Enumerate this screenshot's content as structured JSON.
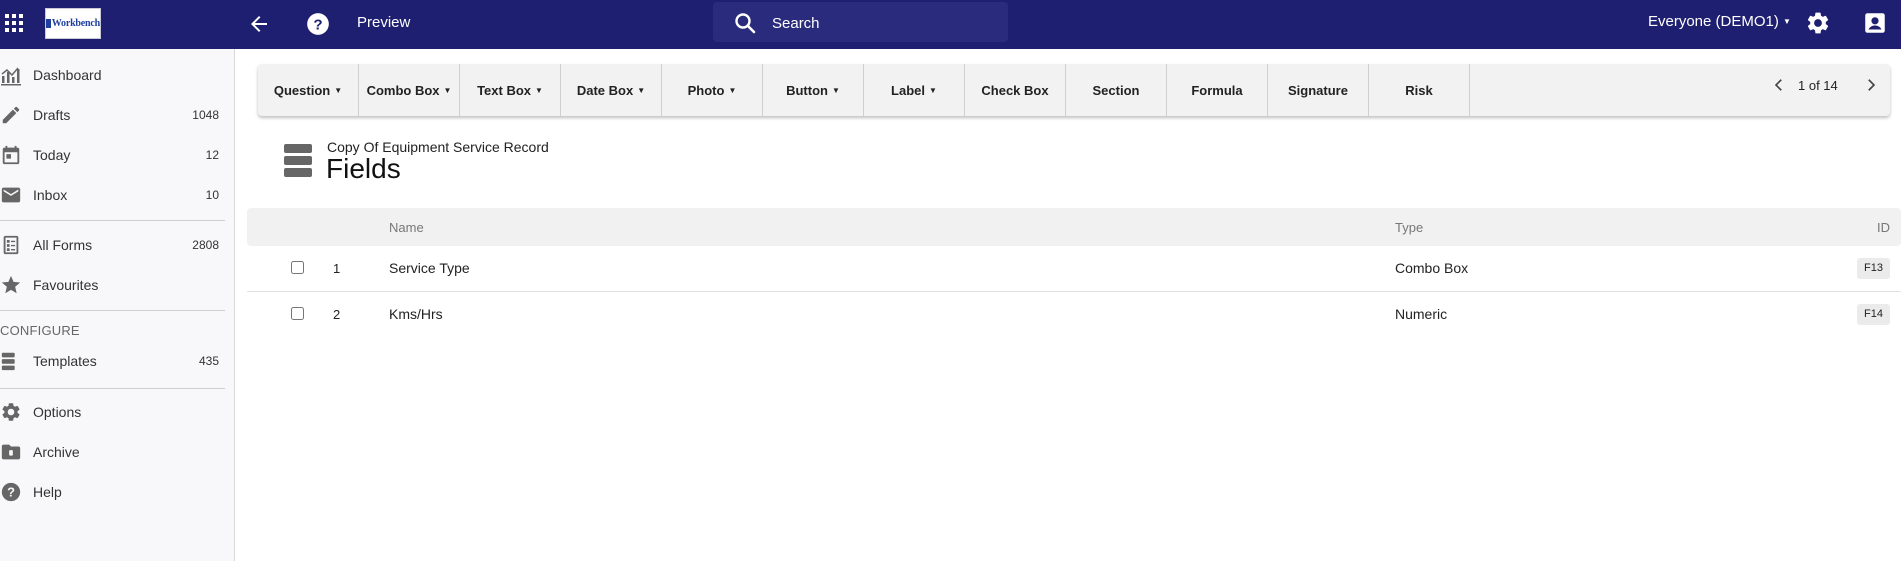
{
  "topbar": {
    "logo_text": "Workbench",
    "preview_label": "Preview",
    "search_placeholder": "Search",
    "workspace_label": "Everyone (DEMO1)",
    "icons": [
      "apps-grid-icon",
      "back-arrow-icon",
      "help-icon",
      "search-icon",
      "settings-gear-icon",
      "account-icon"
    ],
    "colors": {
      "background": "#1f1f71",
      "search_background": "#2b2b7e",
      "text": "#ffffff"
    }
  },
  "sidebar": {
    "items": [
      {
        "label": "Dashboard",
        "count": "",
        "icon": "chart-icon"
      },
      {
        "label": "Drafts",
        "count": "1048",
        "icon": "pencil-icon"
      },
      {
        "label": "Today",
        "count": "12",
        "icon": "calendar-icon"
      },
      {
        "label": "Inbox",
        "count": "10",
        "icon": "mail-icon"
      },
      {
        "label": "All Forms",
        "count": "2808",
        "icon": "forms-list-icon"
      },
      {
        "label": "Favourites",
        "count": "",
        "icon": "star-icon"
      },
      {
        "label": "Templates",
        "count": "435",
        "icon": "stack-icon"
      },
      {
        "label": "Options",
        "count": "",
        "icon": "gear-icon"
      },
      {
        "label": "Archive",
        "count": "",
        "icon": "archive-icon"
      },
      {
        "label": "Help",
        "count": "",
        "icon": "help-circle-icon"
      }
    ],
    "section_configure": "CONFIGURE"
  },
  "toolbar": {
    "buttons": [
      {
        "label": "Question",
        "dropdown": true
      },
      {
        "label": "Combo Box",
        "dropdown": true
      },
      {
        "label": "Text Box",
        "dropdown": true
      },
      {
        "label": "Date Box",
        "dropdown": true
      },
      {
        "label": "Photo",
        "dropdown": true
      },
      {
        "label": "Button",
        "dropdown": true
      },
      {
        "label": "Label",
        "dropdown": true
      },
      {
        "label": "Check Box",
        "dropdown": false
      },
      {
        "label": "Section",
        "dropdown": false
      },
      {
        "label": "Formula",
        "dropdown": false
      },
      {
        "label": "Signature",
        "dropdown": false
      },
      {
        "label": "Risk",
        "dropdown": false
      }
    ],
    "pager_text": "1 of 14"
  },
  "page": {
    "subtitle": "Copy Of Equipment Service Record",
    "title": "Fields"
  },
  "table": {
    "columns": {
      "name": "Name",
      "type": "Type",
      "id": "ID"
    },
    "rows": [
      {
        "num": "1",
        "name": "Service Type",
        "type": "Combo Box",
        "id": "F13",
        "checked": false
      },
      {
        "num": "2",
        "name": "Kms/Hrs",
        "type": "Numeric",
        "id": "F14",
        "checked": false
      }
    ]
  }
}
